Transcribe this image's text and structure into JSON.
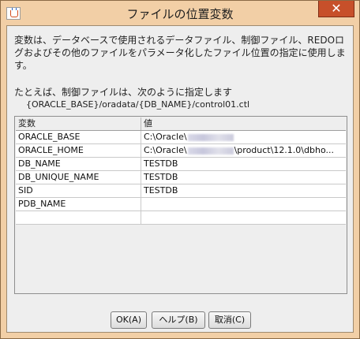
{
  "window": {
    "title": "ファイルの位置変数",
    "close_label": "✕"
  },
  "description": "変数は、データベースで使用されるデータファイル、制御ファイル、REDOログおよびその他のファイルをパラメータ化したファイル位置の指定に使用します。",
  "example": {
    "text": "たとえば、制御ファイルは、次のように指定します",
    "path": "{ORACLE_BASE}/oradata/{DB_NAME}/control01.ctl"
  },
  "table": {
    "columns": [
      "変数",
      "値"
    ],
    "rows": [
      {
        "name": "ORACLE_BASE",
        "value_prefix": "C:\\Oracle\\",
        "value_suffix": ""
      },
      {
        "name": "ORACLE_HOME",
        "value_prefix": "C:\\Oracle\\",
        "value_suffix": "\\product\\12.1.0\\dbho..."
      },
      {
        "name": "DB_NAME",
        "value_prefix": "TESTDB",
        "value_suffix": ""
      },
      {
        "name": "DB_UNIQUE_NAME",
        "value_prefix": "TESTDB",
        "value_suffix": ""
      },
      {
        "name": "SID",
        "value_prefix": "TESTDB",
        "value_suffix": ""
      },
      {
        "name": "PDB_NAME",
        "value_prefix": "",
        "value_suffix": ""
      },
      {
        "name": "",
        "value_prefix": "",
        "value_suffix": ""
      }
    ]
  },
  "buttons": {
    "ok": "OK(A)",
    "help": "ヘルプ(B)",
    "cancel": "取消(C)"
  },
  "colors": {
    "frame": "#f2cfa6",
    "close_button": "#c7502a",
    "content_bg": "#eeeeee"
  }
}
